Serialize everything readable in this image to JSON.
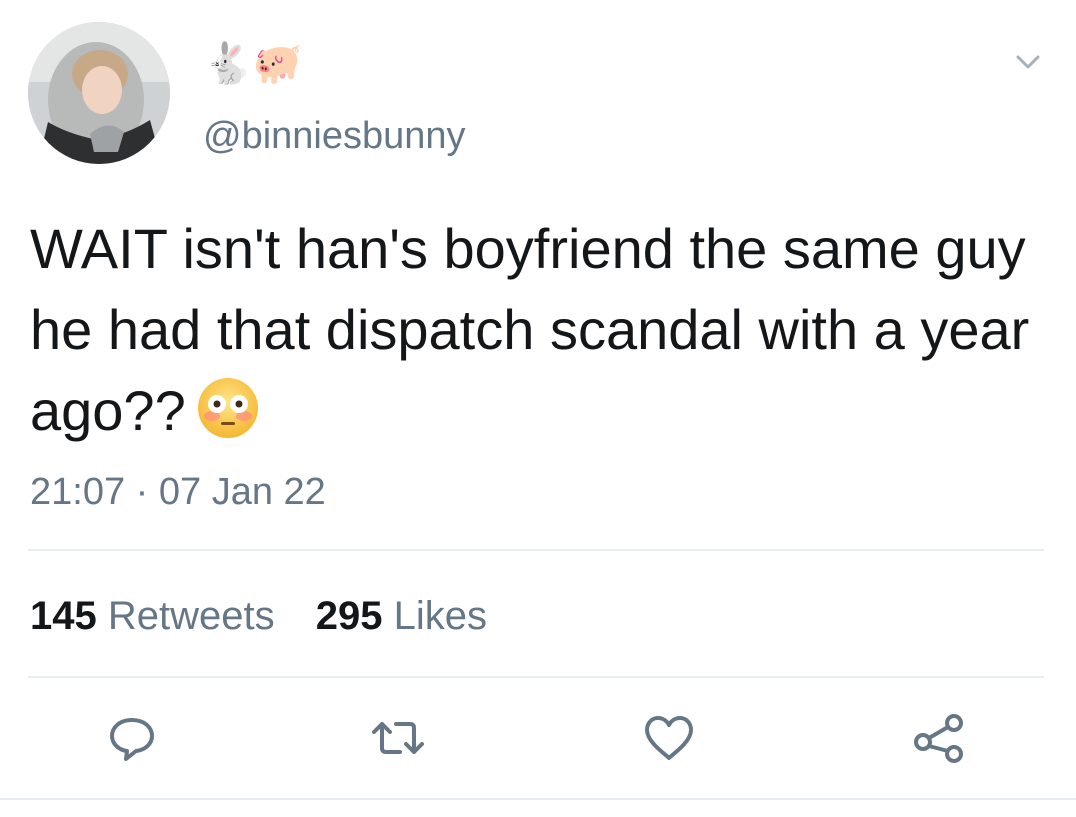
{
  "tweet": {
    "display_name_emoji": "🐇🐖",
    "handle": "@binniesbunny",
    "text": "WAIT isn't han's boyfriend the same guy he had that dispatch scandal with a year ago??",
    "text_emoji": "😳",
    "timestamp": "21:07 · 07 Jan 22"
  },
  "stats": {
    "retweets_count": "145",
    "retweets_label": "Retweets",
    "likes_count": "295",
    "likes_label": "Likes"
  },
  "actions": [
    {
      "icon": "reply-icon"
    },
    {
      "icon": "retweet-icon"
    },
    {
      "icon": "heart-icon"
    },
    {
      "icon": "share-icon"
    }
  ],
  "colors": {
    "text_primary": "#14171a",
    "text_secondary": "#657786",
    "divider": "#e6ecf0",
    "icon": "#657786"
  }
}
